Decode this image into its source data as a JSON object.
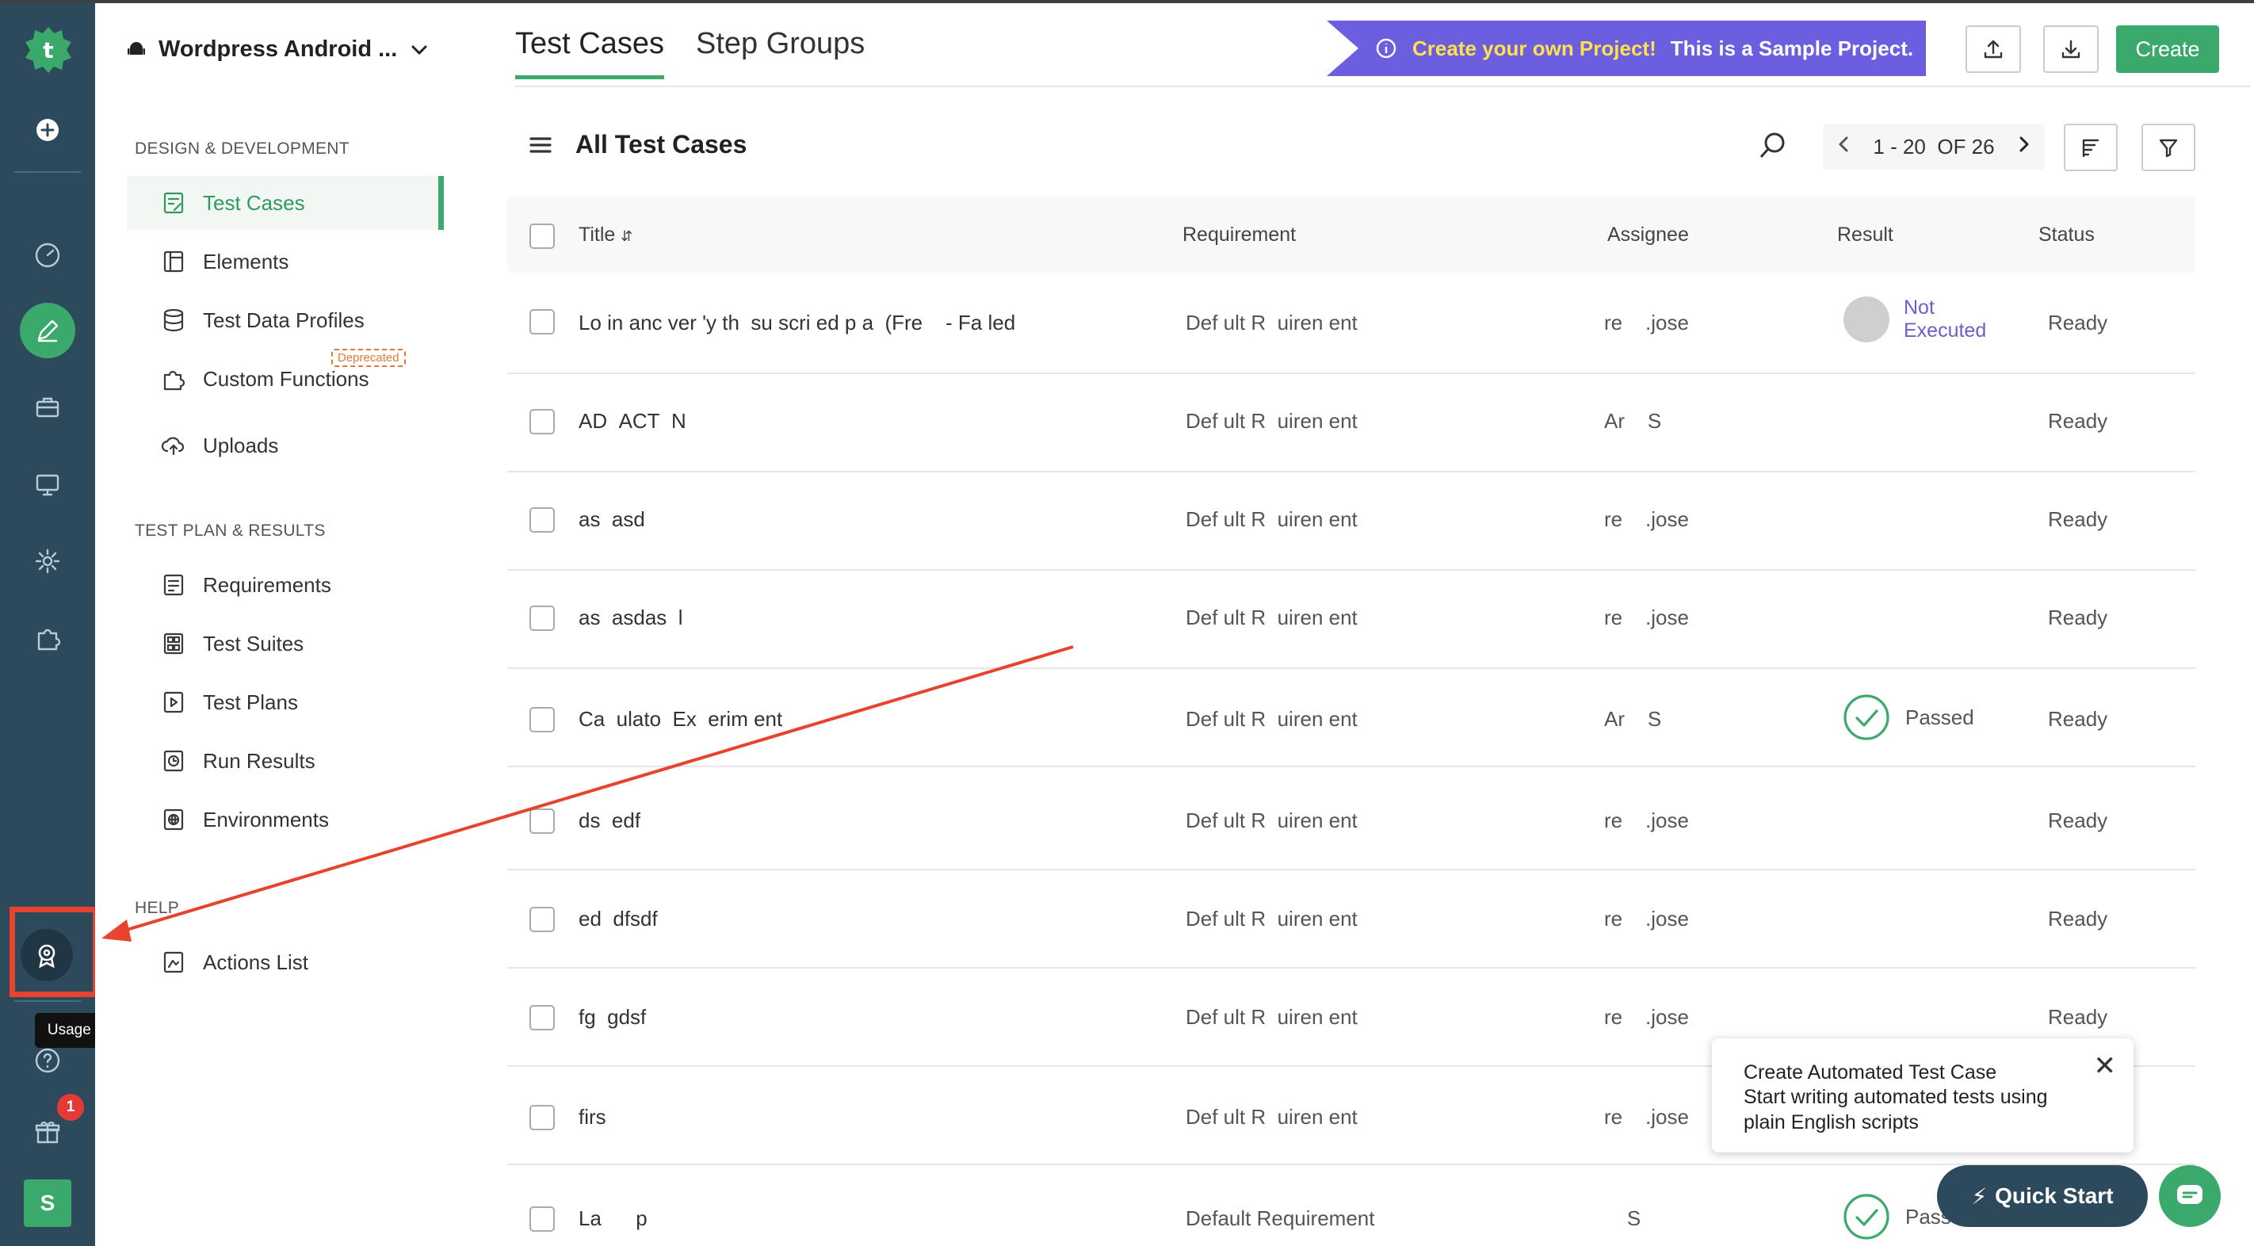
{
  "rail": {
    "tooltip": "Usage Details",
    "gift_badge": "1",
    "avatar_letter": "S"
  },
  "sidebar": {
    "project_name": "Wordpress Android ...",
    "sections": {
      "design": "DESIGN & DEVELOPMENT",
      "plan": "TEST PLAN & RESULTS",
      "help": "HELP"
    },
    "items": [
      {
        "label": "Test Cases"
      },
      {
        "label": "Elements"
      },
      {
        "label": "Test Data Profiles"
      },
      {
        "label": "Custom Functions"
      },
      {
        "label": "Uploads"
      },
      {
        "label": "Requirements"
      },
      {
        "label": "Test Suites"
      },
      {
        "label": "Test Plans"
      },
      {
        "label": "Run Results"
      },
      {
        "label": "Environments"
      },
      {
        "label": "Actions List"
      }
    ],
    "deprecated_label": "Deprecated"
  },
  "header": {
    "tabs": [
      {
        "label": "Test Cases"
      },
      {
        "label": "Step Groups"
      }
    ],
    "banner_highlight": "Create your own Project!",
    "banner_text": "This is a Sample Project.",
    "create_label": "Create"
  },
  "list": {
    "title": "All Test Cases",
    "pager_range": "1 - 20",
    "pager_of": "OF 26",
    "columns": {
      "title": "Title",
      "requirement": "Requirement",
      "assignee": "Assignee",
      "result": "Result",
      "status": "Status"
    },
    "rows": [
      {
        "title": "Lo in anc ver 'y th  su scri ed p a  (Fre    - Fa led",
        "requirement": "Def ult R  uiren ent",
        "assignee": "re    .jose",
        "result": "Not Executed",
        "status": "Ready"
      },
      {
        "title": "AD  ACT  N ",
        "requirement": "Def ult R  uiren ent",
        "assignee": "Ar    S",
        "result": "",
        "status": "Ready"
      },
      {
        "title": "as  asd",
        "requirement": "Def ult R  uiren ent",
        "assignee": "re    .jose",
        "result": "",
        "status": "Ready"
      },
      {
        "title": "as  asdas  l",
        "requirement": "Def ult R  uiren ent",
        "assignee": "re    .jose",
        "result": "",
        "status": "Ready"
      },
      {
        "title": "Ca  ulato  Ex  erim ent",
        "requirement": "Def ult R  uiren ent",
        "assignee": "Ar    S",
        "result": "Passed",
        "status": "Ready"
      },
      {
        "title": "ds  edf",
        "requirement": "Def ult R  uiren ent",
        "assignee": "re    .jose",
        "result": "",
        "status": "Ready"
      },
      {
        "title": "ed  dfsdf",
        "requirement": "Def ult R  uiren ent",
        "assignee": "re    .jose",
        "result": "",
        "status": "Ready"
      },
      {
        "title": "fg  gdsf",
        "requirement": "Def ult R  uiren ent",
        "assignee": "re    .jose",
        "result": "",
        "status": "Ready"
      },
      {
        "title": "firs",
        "requirement": "Def ult R  uiren ent",
        "assignee": "re    .jose",
        "result": "",
        "status": ""
      },
      {
        "title": "La      p",
        "requirement": "Default Requirement",
        "assignee": "    S",
        "result": "Pass",
        "status": ""
      }
    ]
  },
  "popup": {
    "title": "Create Automated Test Case",
    "body": "Start writing automated tests using plain English scripts"
  },
  "quick_start_label": "Quick Start",
  "colors": {
    "accent": "#3aa96b",
    "rail": "#2c4a5c",
    "banner": "#6b5fe0",
    "annotation": "#e8432e"
  }
}
